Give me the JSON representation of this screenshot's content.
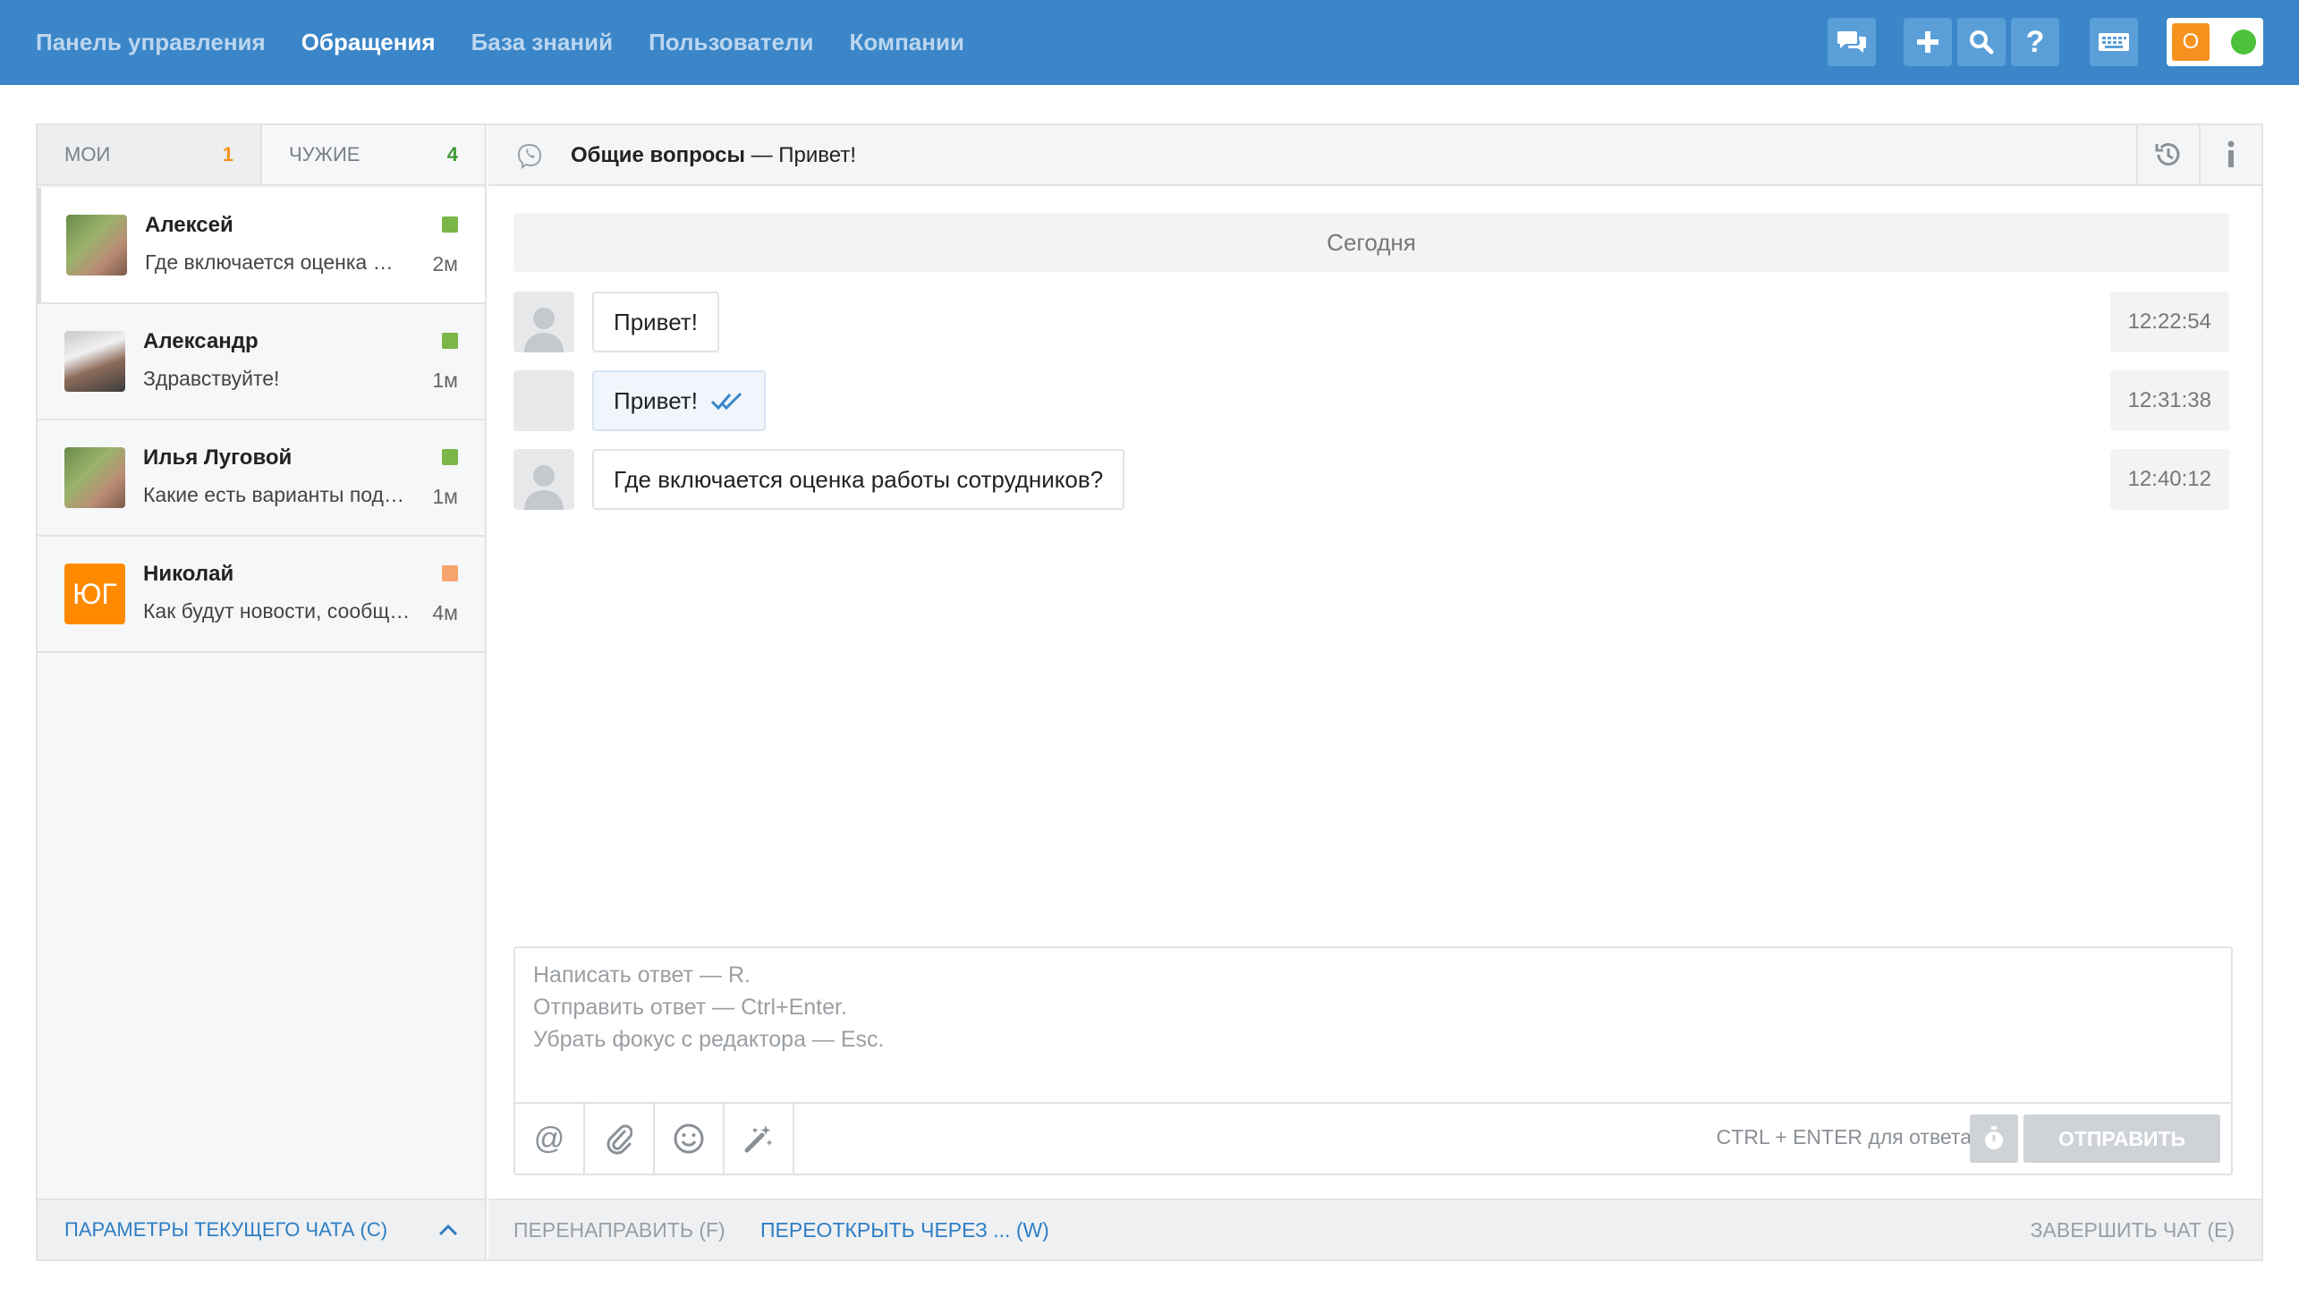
{
  "nav": {
    "items": [
      {
        "label": "Панель управления",
        "active": false
      },
      {
        "label": "Обращения",
        "active": true
      },
      {
        "label": "База знаний",
        "active": false
      },
      {
        "label": "Пользователи",
        "active": false
      },
      {
        "label": "Компании",
        "active": false
      }
    ],
    "status_letter": "О"
  },
  "tabs": {
    "mine_label": "МОИ",
    "mine_count": "1",
    "others_label": "ЧУЖИЕ",
    "others_count": "4"
  },
  "chats": [
    {
      "name": "Алексей",
      "snippet": "Где включается оценка работы сотрудников?",
      "time": "2м",
      "status_color": "#7ab648"
    },
    {
      "name": "Александр",
      "snippet": "Здравствуйте!",
      "time": "1м",
      "status_color": "#7ab648"
    },
    {
      "name": "Илья Луговой",
      "snippet": "Какие есть варианты подключения?",
      "time": "1м",
      "status_color": "#7ab648"
    },
    {
      "name": "Николай",
      "snippet": "Как будут новости, сообщите",
      "time": "4м",
      "status_color": "#f5a46e",
      "initials": "ЮГ"
    }
  ],
  "left_footer": {
    "label": "ПАРАМЕТРЫ ТЕКУЩЕГО ЧАТА (C)"
  },
  "chat_header": {
    "channel": "Общие вопросы",
    "separator": " — ",
    "subject": "Привет!"
  },
  "day_label": "Сегодня",
  "messages": [
    {
      "text": "Привет!",
      "time": "12:22:54"
    },
    {
      "text": "Привет!",
      "time": "12:31:38"
    },
    {
      "text": "Где включается оценка работы сотрудников?",
      "time": "12:40:12"
    }
  ],
  "editor": {
    "placeholder_lines": [
      "Написать ответ — R.",
      "Отправить ответ — Ctrl+Enter.",
      "Убрать фокус с редактора — Esc."
    ],
    "hint": "CTRL + ENTER для ответа",
    "send_label": "ОТПРАВИТЬ"
  },
  "chat_footer": {
    "redirect": "ПЕРЕНАПРАВИТЬ (F)",
    "reopen": "ПЕРЕОТКРЫТЬ ЧЕРЕЗ ... (W)",
    "finish": "ЗАВЕРШИТЬ ЧАТ (E)"
  },
  "colors": {
    "topbar": "#3a86c8",
    "link": "#2e7ec4",
    "mine_count": "#f7921e",
    "others_count": "#3f9c35"
  }
}
